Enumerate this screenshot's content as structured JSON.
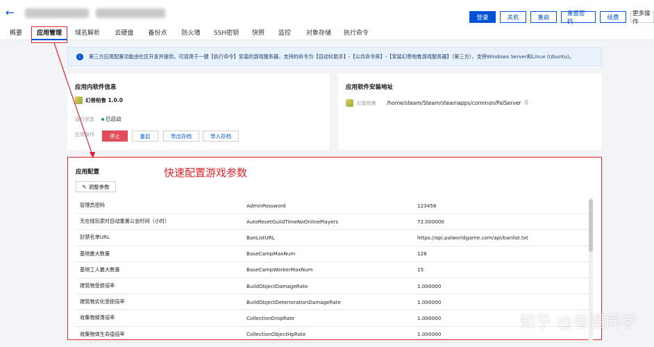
{
  "header": {
    "back_icon": "arrow-left-icon",
    "actions": [
      "登录",
      "关机",
      "重启",
      "重置密码",
      "续费",
      "更多操作"
    ]
  },
  "tabs": [
    "概要",
    "应用管理",
    "域名解析",
    "云硬盘",
    "备份点",
    "防火墙",
    "SSH密钥",
    "快照",
    "监控",
    "对象存储",
    "执行命令"
  ],
  "notice": {
    "icon": "info-icon",
    "text": "第三方应用配置功能由社区开发并提供。可适用于一键【执行命令】安装的游戏服务器，支持的命令为【自动化助手】-【公共命令库】-【安装幻兽帕鲁游戏服务器】（第三方），支持Windows Server和Linux (Ubuntu)。"
  },
  "software_card": {
    "title": "应用内软件信息",
    "app_name": "幻兽帕鲁 1.0.0",
    "status_label": "运行状态",
    "status_value": "已启动",
    "ops_label": "应用操作",
    "buttons": [
      "停止",
      "重启",
      "导出存档",
      "导入存档"
    ]
  },
  "install_card": {
    "title": "应用软件安装地址",
    "app_label": "幻兽帕鲁",
    "path": "/home/steam/Steam/steamapps/common/PalServer"
  },
  "config": {
    "title": "应用配置",
    "annotation": "快速配置游戏参数",
    "adjust_button": "调整参数",
    "rows": [
      [
        "管理员密码",
        "AdminPassword",
        "123456"
      ],
      [
        "无在线玩家时自动重置公会时间（小时）",
        "AutoResetGuildTimeNoOnlinePlayers",
        "72.000000"
      ],
      [
        "封禁名单URL",
        "BanListURL",
        "https://api.palworldgame.com/api/banlist.txt"
      ],
      [
        "基地最大数量",
        "BaseCampMaxNum",
        "128"
      ],
      [
        "基地工人最大数量",
        "BaseCampWorkerMaxNum",
        "15"
      ],
      [
        "建筑物受损倍率",
        "BuildObjectDamageRate",
        "1.000000"
      ],
      [
        "建筑物劣化受损倍率",
        "BuildObjectDeteriorationDamageRate",
        "1.000000"
      ],
      [
        "收集物掉落倍率",
        "CollectionDropRate",
        "1.000000"
      ],
      [
        "收集物体生命值倍率",
        "CollectionObjectHpRate",
        "1.000000"
      ]
    ]
  },
  "watermark": "知乎 @卷福同学",
  "colors": {
    "primary": "#0052d9",
    "danger": "#e34d59",
    "highlight": "#e0242d",
    "success": "#00a870"
  }
}
